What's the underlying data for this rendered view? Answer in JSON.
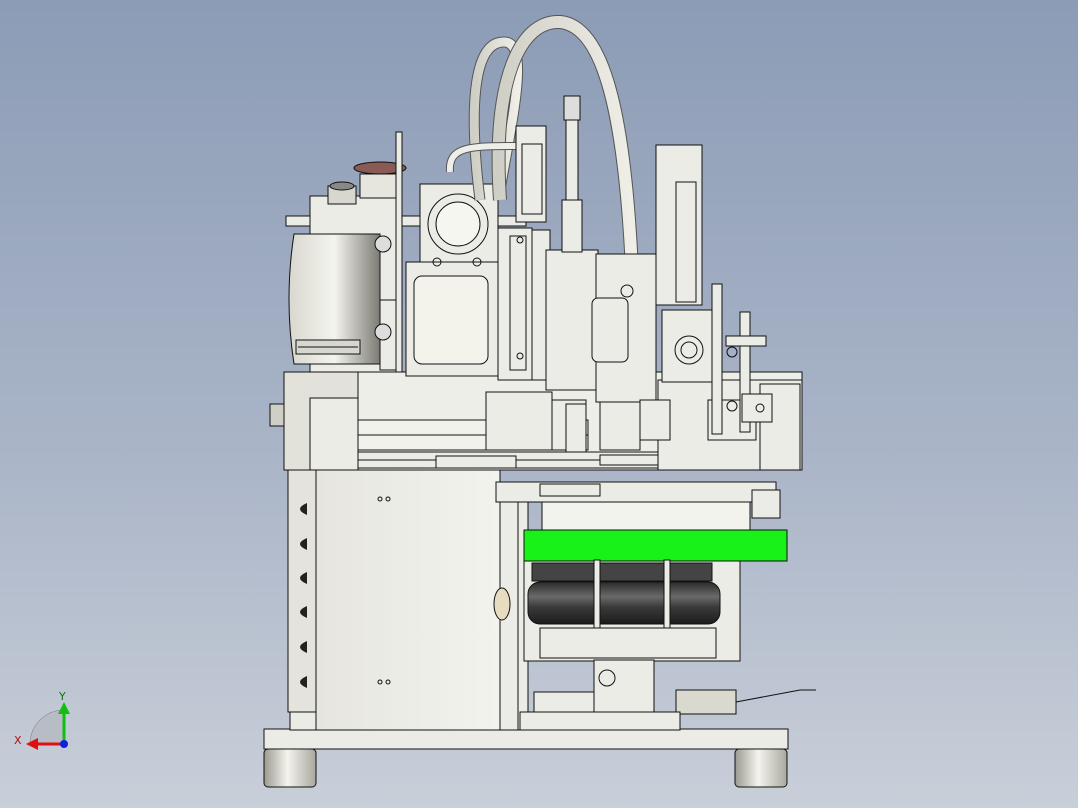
{
  "view": {
    "background_top": "#8c9cb6",
    "background_bottom": "#c9cfd9",
    "highlight_color": "#19f219"
  },
  "axis_triad": {
    "x_label": "X",
    "y_label": "Y",
    "x_color": "#e01010",
    "y_color": "#10c010",
    "z_color": "#1020e0"
  }
}
